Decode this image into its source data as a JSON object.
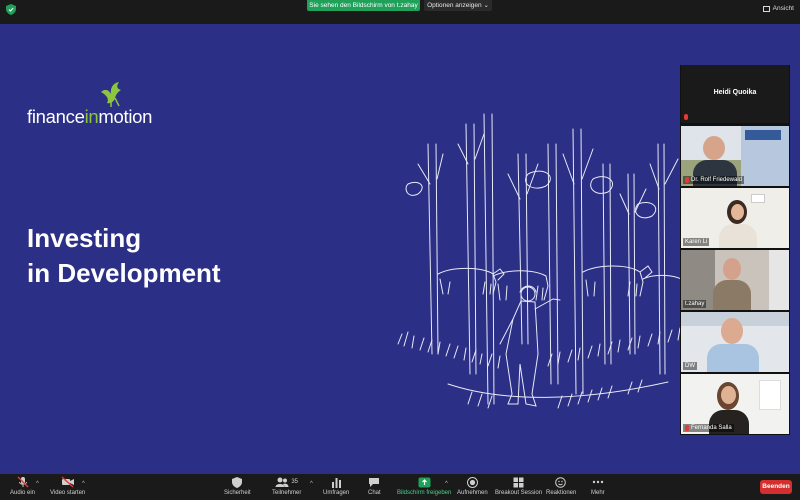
{
  "topbar": {
    "share_status": "Sie sehen den Bildschirm von t.zahay",
    "options_label": "Optionen anzeigen",
    "view_label": "Ansicht"
  },
  "slide": {
    "logo_part1": "finance",
    "logo_accent": "in",
    "logo_part3": "motion",
    "title_line1": "Investing",
    "title_line2": "in Development",
    "background_color": "#2b2f85",
    "accent_color": "#8cc63f"
  },
  "gallery": {
    "active_speaker": "Heidi Quoika",
    "participants": [
      {
        "name": "Dr. Rolf Friedewald"
      },
      {
        "name": "Karen Li"
      },
      {
        "name": "t.zahay"
      },
      {
        "name": "DW"
      },
      {
        "name": "Fernanda Salla"
      }
    ]
  },
  "toolbar": {
    "audio_label": "Audio ein",
    "video_label": "Video starten",
    "security_label": "Sicherheit",
    "participants_label": "Teilnehmer",
    "participants_count": "35",
    "polls_label": "Umfragen",
    "chat_label": "Chat",
    "share_label": "Bildschirm freigeben",
    "record_label": "Aufnehmen",
    "breakout_label": "Breakout Session",
    "reactions_label": "Reaktionen",
    "more_label": "Mehr",
    "end_label": "Beenden",
    "share_color": "#1fa15a",
    "end_color": "#d32f2f"
  }
}
